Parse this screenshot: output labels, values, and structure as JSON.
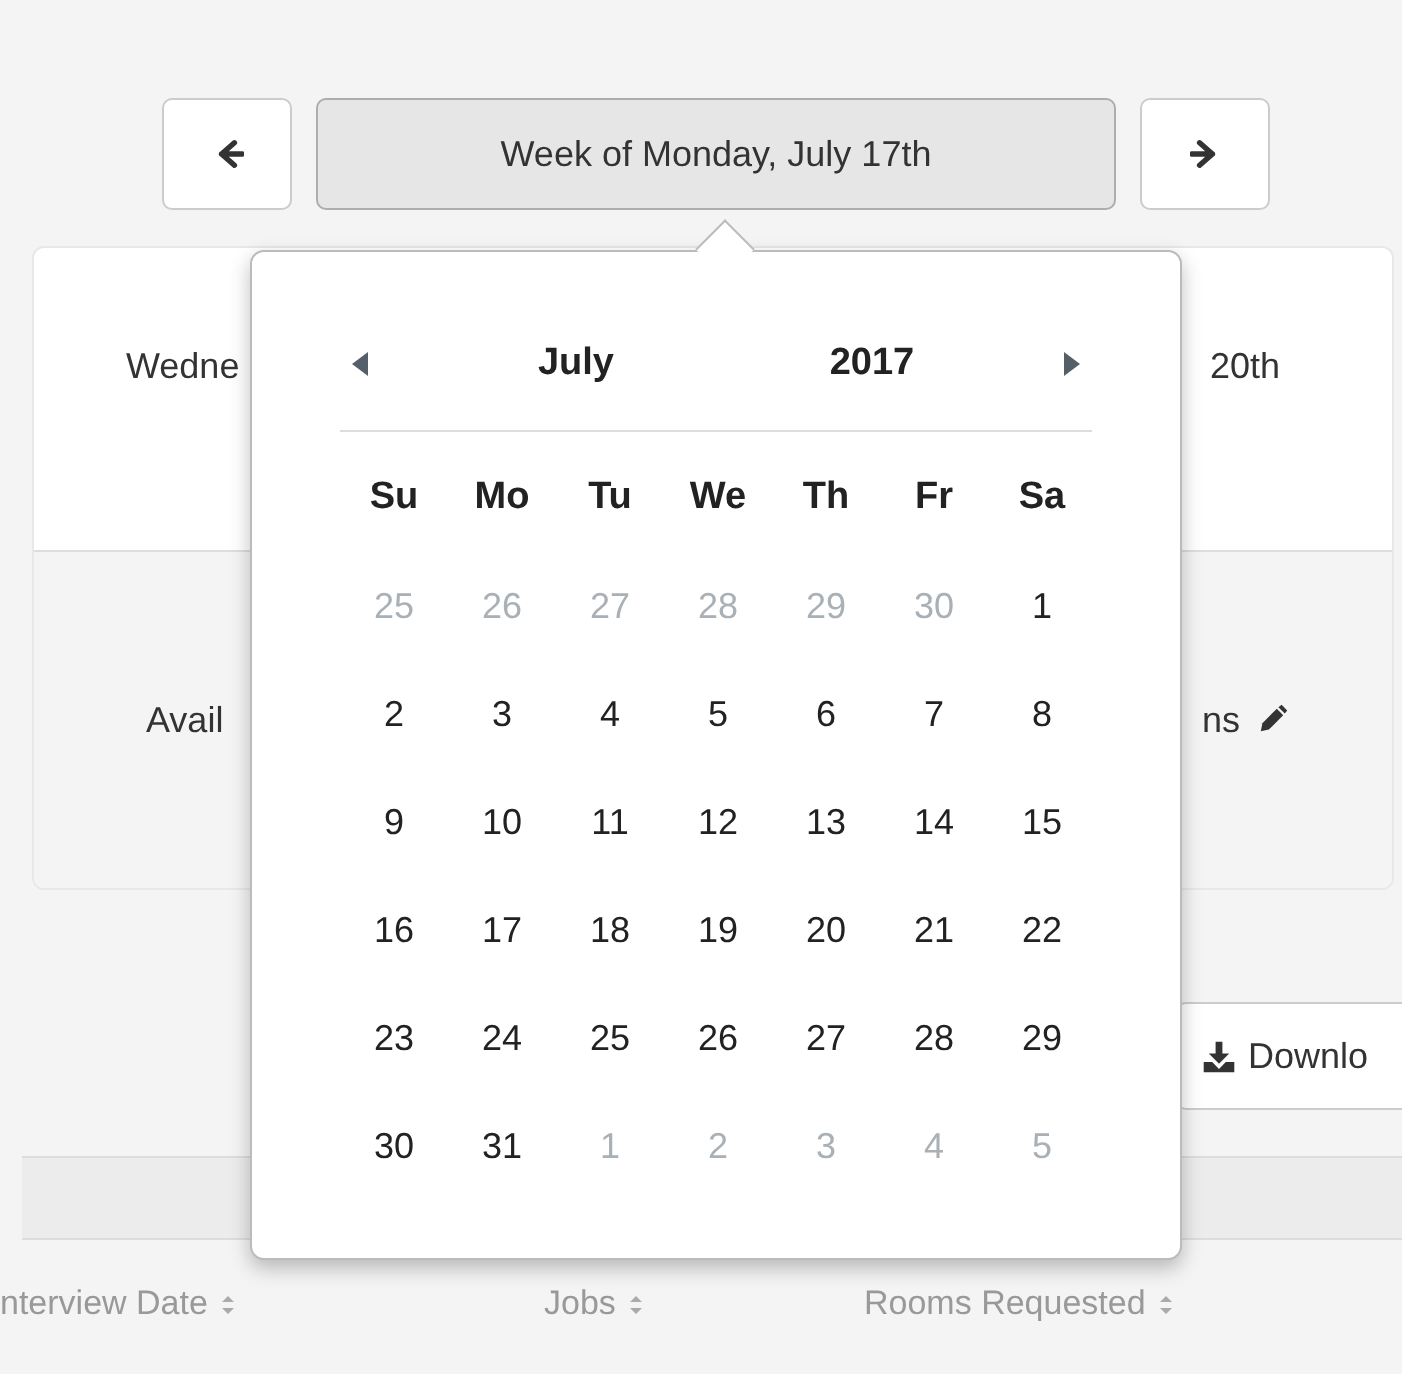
{
  "week_nav": {
    "label": "Week of Monday, July 17th"
  },
  "card": {
    "day_row": {
      "left": "Wedne",
      "right": "20th"
    },
    "availability_row": {
      "left": "Avail",
      "right": "ns"
    }
  },
  "download_button": {
    "label": "Downlo"
  },
  "table": {
    "columns": [
      {
        "label": "nterview Date"
      },
      {
        "label": "Jobs"
      },
      {
        "label": "Rooms Requested"
      }
    ]
  },
  "datepicker": {
    "month": "July",
    "year": "2017",
    "weekdays": [
      "Su",
      "Mo",
      "Tu",
      "We",
      "Th",
      "Fr",
      "Sa"
    ],
    "weeks": [
      [
        {
          "label": "25",
          "muted": true
        },
        {
          "label": "26",
          "muted": true
        },
        {
          "label": "27",
          "muted": true
        },
        {
          "label": "28",
          "muted": true
        },
        {
          "label": "29",
          "muted": true
        },
        {
          "label": "30",
          "muted": true
        },
        {
          "label": "1",
          "muted": false
        }
      ],
      [
        {
          "label": "2",
          "muted": false
        },
        {
          "label": "3",
          "muted": false
        },
        {
          "label": "4",
          "muted": false
        },
        {
          "label": "5",
          "muted": false
        },
        {
          "label": "6",
          "muted": false
        },
        {
          "label": "7",
          "muted": false
        },
        {
          "label": "8",
          "muted": false
        }
      ],
      [
        {
          "label": "9",
          "muted": false
        },
        {
          "label": "10",
          "muted": false
        },
        {
          "label": "11",
          "muted": false
        },
        {
          "label": "12",
          "muted": false
        },
        {
          "label": "13",
          "muted": false
        },
        {
          "label": "14",
          "muted": false
        },
        {
          "label": "15",
          "muted": false
        }
      ],
      [
        {
          "label": "16",
          "muted": false
        },
        {
          "label": "17",
          "muted": false
        },
        {
          "label": "18",
          "muted": false
        },
        {
          "label": "19",
          "muted": false
        },
        {
          "label": "20",
          "muted": false
        },
        {
          "label": "21",
          "muted": false
        },
        {
          "label": "22",
          "muted": false
        }
      ],
      [
        {
          "label": "23",
          "muted": false
        },
        {
          "label": "24",
          "muted": false
        },
        {
          "label": "25",
          "muted": false
        },
        {
          "label": "26",
          "muted": false
        },
        {
          "label": "27",
          "muted": false
        },
        {
          "label": "28",
          "muted": false
        },
        {
          "label": "29",
          "muted": false
        }
      ],
      [
        {
          "label": "30",
          "muted": false
        },
        {
          "label": "31",
          "muted": false
        },
        {
          "label": "1",
          "muted": true
        },
        {
          "label": "2",
          "muted": true
        },
        {
          "label": "3",
          "muted": true
        },
        {
          "label": "4",
          "muted": true
        },
        {
          "label": "5",
          "muted": true
        }
      ]
    ]
  }
}
